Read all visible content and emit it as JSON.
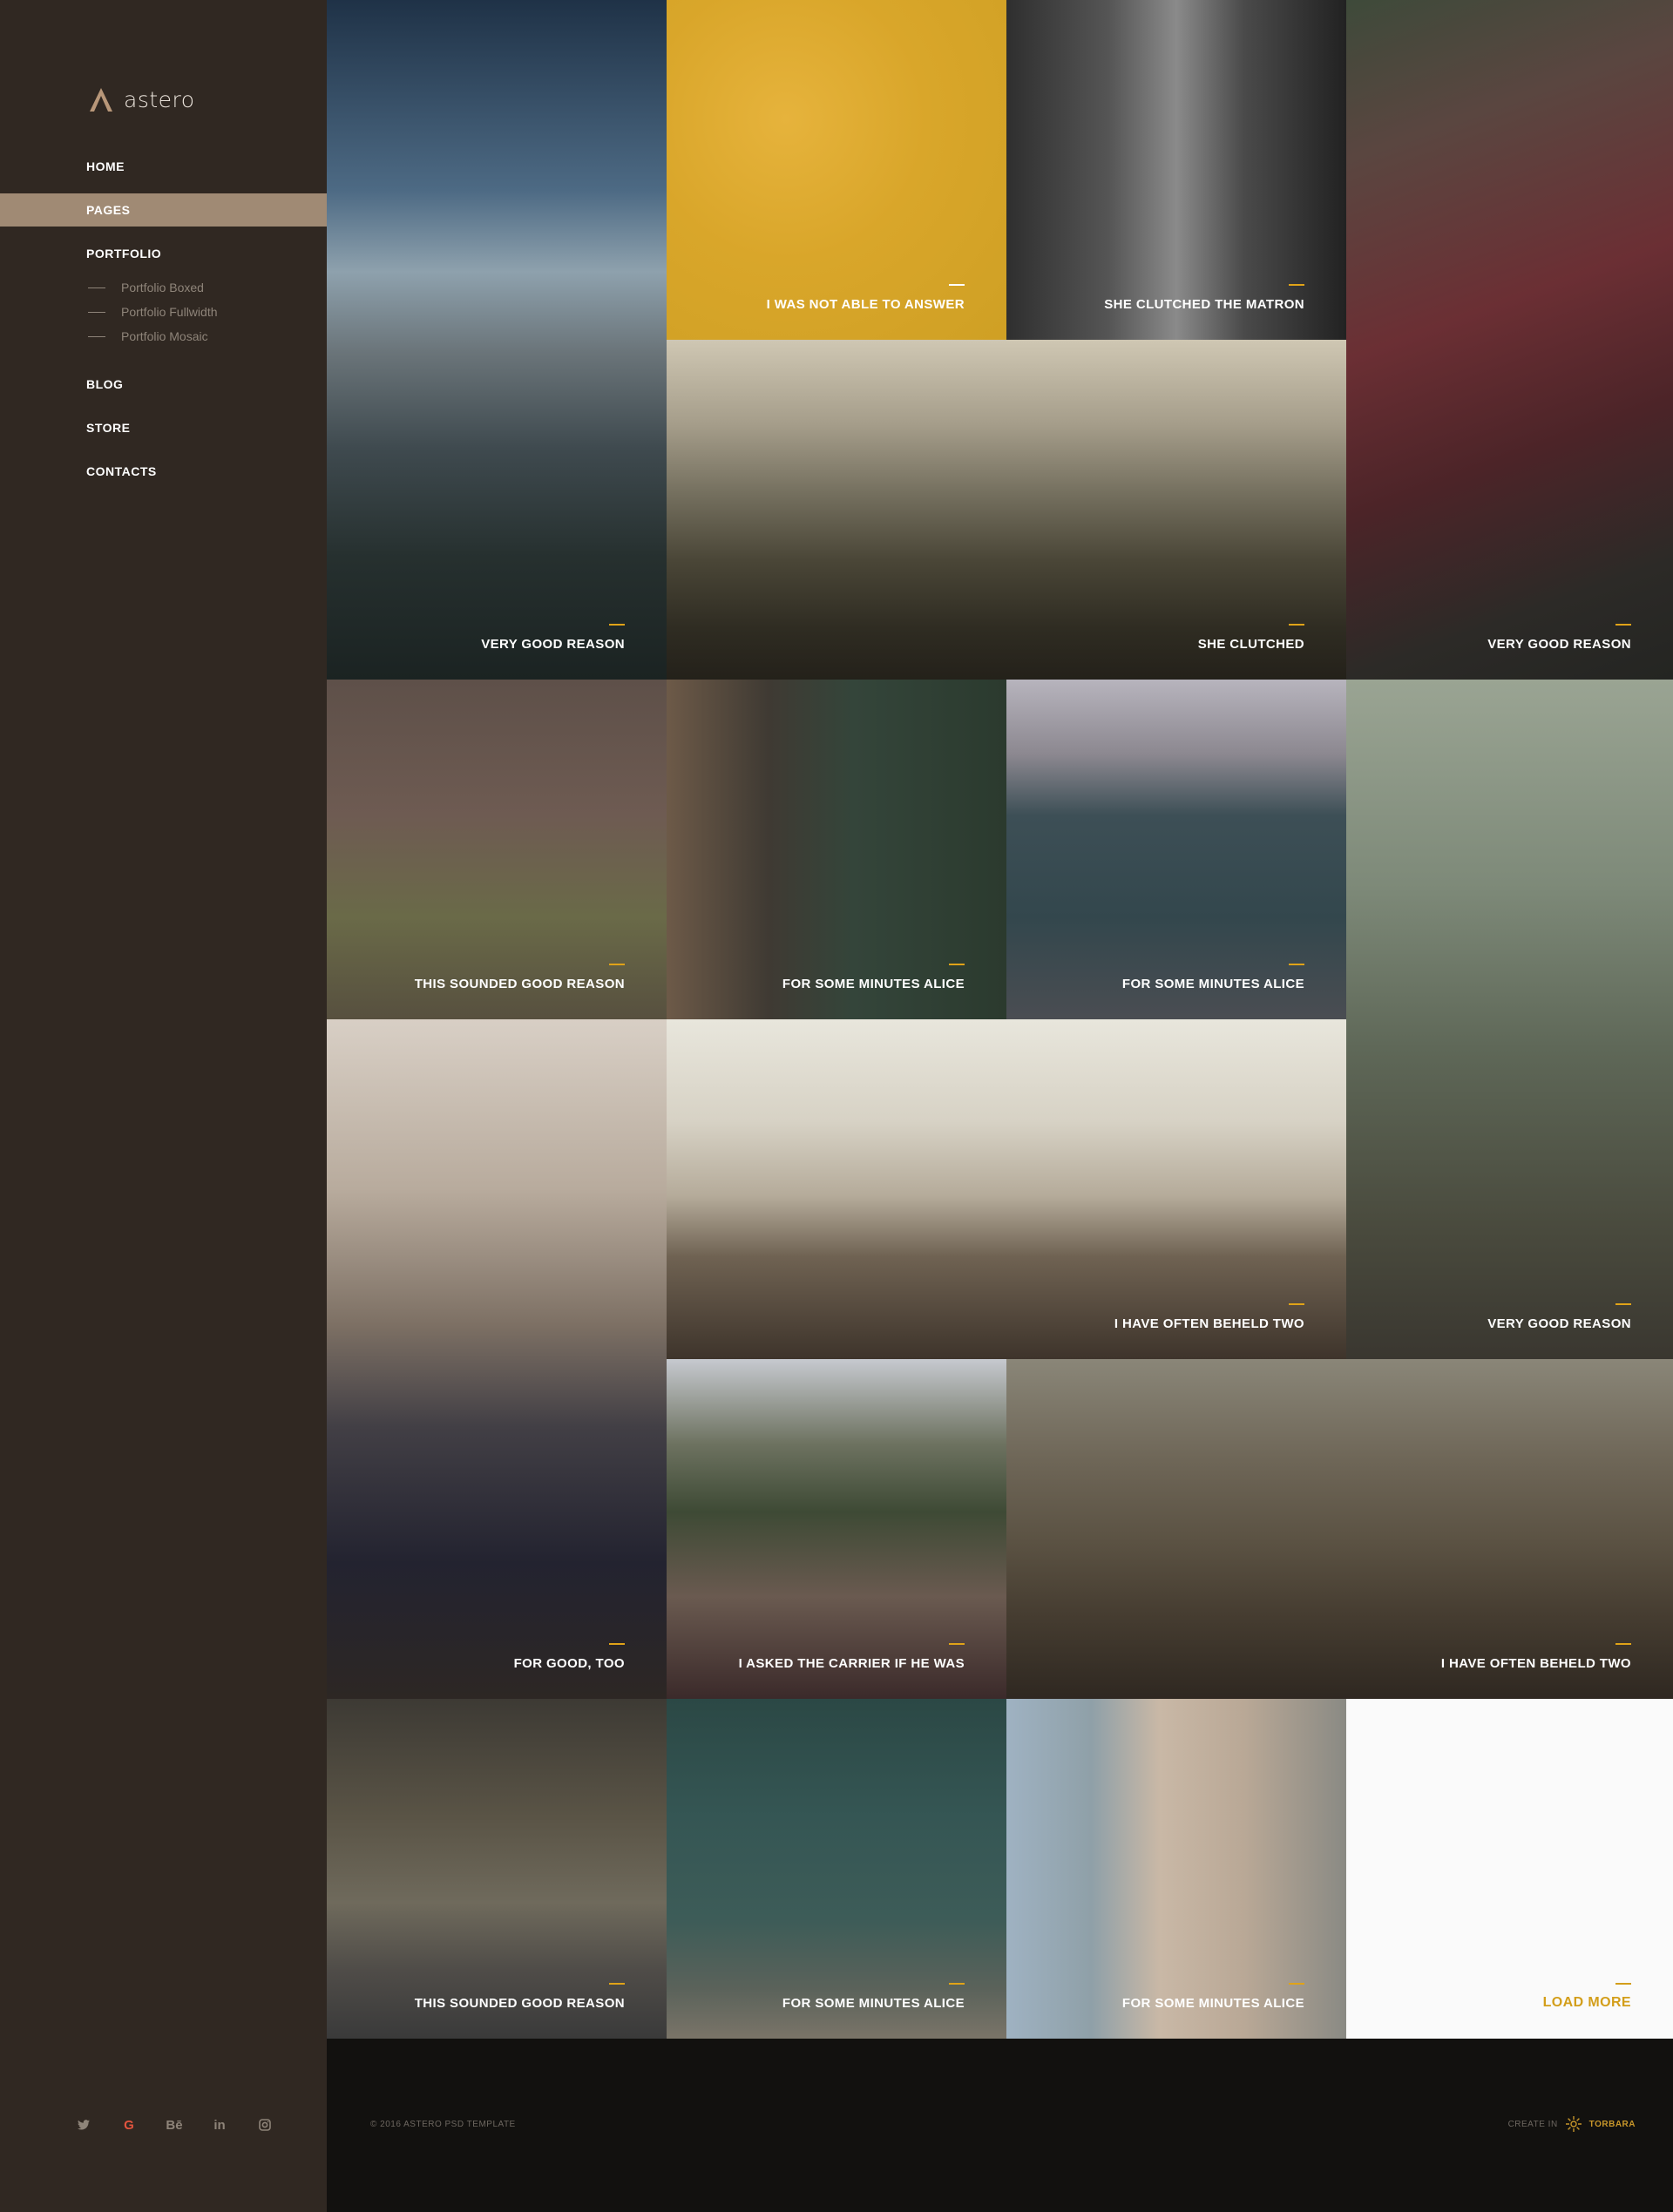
{
  "brand": {
    "name": "astero",
    "accent": "#a08a74",
    "highlight": "#e0a318"
  },
  "nav": {
    "home": "HOME",
    "pages": "PAGES",
    "portfolio": "PORTFOLIO",
    "portfolio_items": [
      "Portfolio Boxed",
      "Portfolio Fullwidth",
      "Portfolio Mosaic"
    ],
    "blog": "BLOG",
    "store": "STORE",
    "contacts": "CONTACTS",
    "active": "PAGES"
  },
  "social": {
    "twitter": "🐦",
    "google": "G",
    "behance": "Bē",
    "linkedin": "in",
    "instagram": "◙"
  },
  "tiles": [
    {
      "caption": "VERY GOOD REASON"
    },
    {
      "caption": "I WAS NOT ABLE TO ANSWER"
    },
    {
      "caption": "SHE CLUTCHED THE MATRON"
    },
    {
      "caption": "VERY GOOD REASON"
    },
    {
      "caption": "SHE CLUTCHED"
    },
    {
      "caption": "THIS SOUNDED GOOD REASON"
    },
    {
      "caption": "FOR SOME MINUTES ALICE"
    },
    {
      "caption": "FOR SOME MINUTES ALICE"
    },
    {
      "caption": "VERY GOOD REASON"
    },
    {
      "caption": "FOR GOOD, TOO"
    },
    {
      "caption": "I HAVE OFTEN BEHELD TWO"
    },
    {
      "caption": "I ASKED THE CARRIER IF HE WAS"
    },
    {
      "caption": "I HAVE OFTEN BEHELD TWO"
    },
    {
      "caption": "THIS SOUNDED GOOD REASON"
    },
    {
      "caption": "FOR SOME MINUTES ALICE"
    },
    {
      "caption": "FOR SOME MINUTES ALICE"
    },
    {
      "caption": "LOAD MORE"
    }
  ],
  "footer": {
    "copyright": "© 2016 ASTERO PSD TEMPLATE",
    "created_in": "CREATE IN",
    "agency": "TORBARA"
  }
}
